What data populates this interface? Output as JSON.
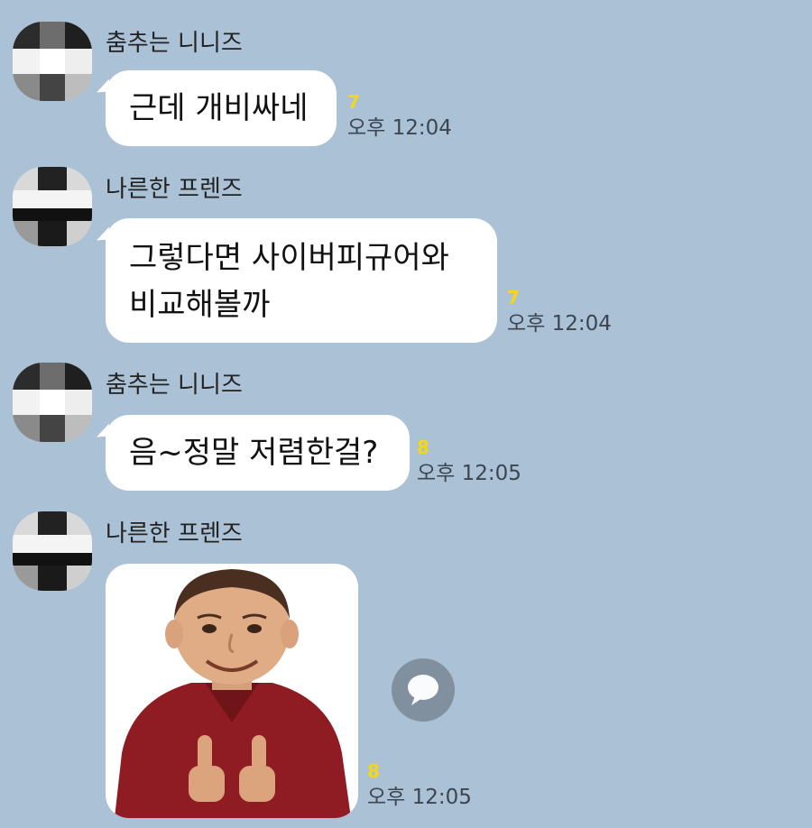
{
  "messages": [
    {
      "sender": "춤추는 니니즈",
      "lines": [
        "근데 개비싸네"
      ],
      "unread": "7",
      "time": "오후 12:04"
    },
    {
      "sender": "나른한 프렌즈",
      "lines": [
        "그렇다면 사이버피규어와",
        "비교해볼까"
      ],
      "unread": "7",
      "time": "오후 12:04"
    },
    {
      "sender": "춤추는 니니즈",
      "lines": [
        "음~정말 저렴한걸?"
      ],
      "unread": "8",
      "time": "오후 12:05"
    },
    {
      "sender": "나른한 프렌즈",
      "image": "photo-of-smiling-boy-thumbs-up",
      "unread": "8",
      "time": "오후 12:05"
    }
  ],
  "icons": {
    "share": "speech-bubble-icon"
  },
  "colors": {
    "background": "#abc1d6",
    "bubble": "#ffffff",
    "unread": "#f5d814",
    "time": "#3c4651"
  }
}
